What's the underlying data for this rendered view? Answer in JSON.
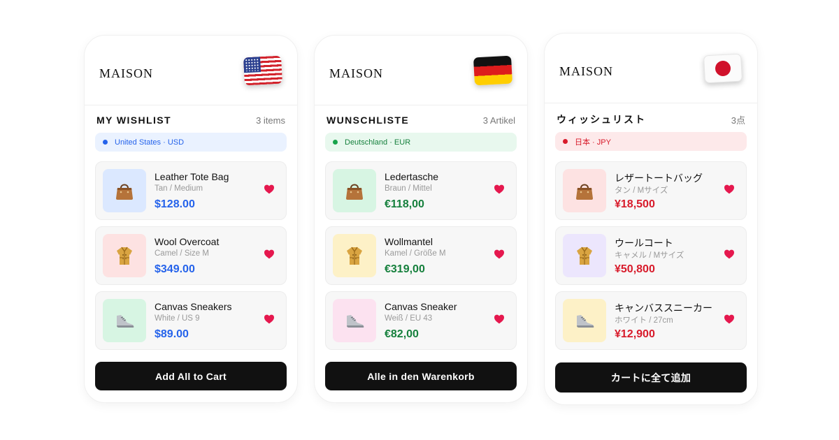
{
  "colors": {
    "us_accent": "#2563eb",
    "de_accent": "#16803d",
    "jp_accent": "#d81b2b",
    "heart": "#e5184e",
    "cta_background": "#111111"
  },
  "cards": [
    {
      "brand": "MAISON",
      "flag_icon": "flag-us-icon",
      "list_title": "MY WISHLIST",
      "item_count": "3 items",
      "region": "United States · USD",
      "items": [
        {
          "name": "Leather Tote Bag",
          "variant": "Tan / Medium",
          "price": "$128.00",
          "icon": "handbag-icon",
          "thumb_color": "#dbe8ff"
        },
        {
          "name": "Wool Overcoat",
          "variant": "Camel / Size M",
          "price": "$349.00",
          "icon": "coat-icon",
          "thumb_color": "#fde2e2"
        },
        {
          "name": "Canvas Sneakers",
          "variant": "White / US 9",
          "price": "$89.00",
          "icon": "sneaker-icon",
          "thumb_color": "#d7f5e3"
        }
      ],
      "cta": "Add All to Cart"
    },
    {
      "brand": "MAISON",
      "flag_icon": "flag-de-icon",
      "list_title": "WUNSCHLISTE",
      "item_count": "3 Artikel",
      "region": "Deutschland · EUR",
      "items": [
        {
          "name": "Ledertasche",
          "variant": "Braun / Mittel",
          "price": "€118,00",
          "icon": "handbag-icon",
          "thumb_color": "#d7f5e3"
        },
        {
          "name": "Wollmantel",
          "variant": "Kamel / Größe M",
          "price": "€319,00",
          "icon": "coat-icon",
          "thumb_color": "#fdf1c7"
        },
        {
          "name": "Canvas Sneaker",
          "variant": "Weiß / EU 43",
          "price": "€82,00",
          "icon": "sneaker-icon",
          "thumb_color": "#fce2f0"
        }
      ],
      "cta": "Alle in den Warenkorb"
    },
    {
      "brand": "MAISON",
      "flag_icon": "flag-jp-icon",
      "list_title": "ウィッシュリスト",
      "item_count": "3点",
      "region": "日本 · JPY",
      "items": [
        {
          "name": "レザートートバッグ",
          "variant": "タン / Mサイズ",
          "price": "¥18,500",
          "icon": "handbag-icon",
          "thumb_color": "#fde2e2"
        },
        {
          "name": "ウールコート",
          "variant": "キャメル / Mサイズ",
          "price": "¥50,800",
          "icon": "coat-icon",
          "thumb_color": "#ece6fd"
        },
        {
          "name": "キャンバススニーカー",
          "variant": "ホワイト / 27cm",
          "price": "¥12,900",
          "icon": "sneaker-icon",
          "thumb_color": "#fdf1c7"
        }
      ],
      "cta": "カートに全て追加"
    }
  ]
}
